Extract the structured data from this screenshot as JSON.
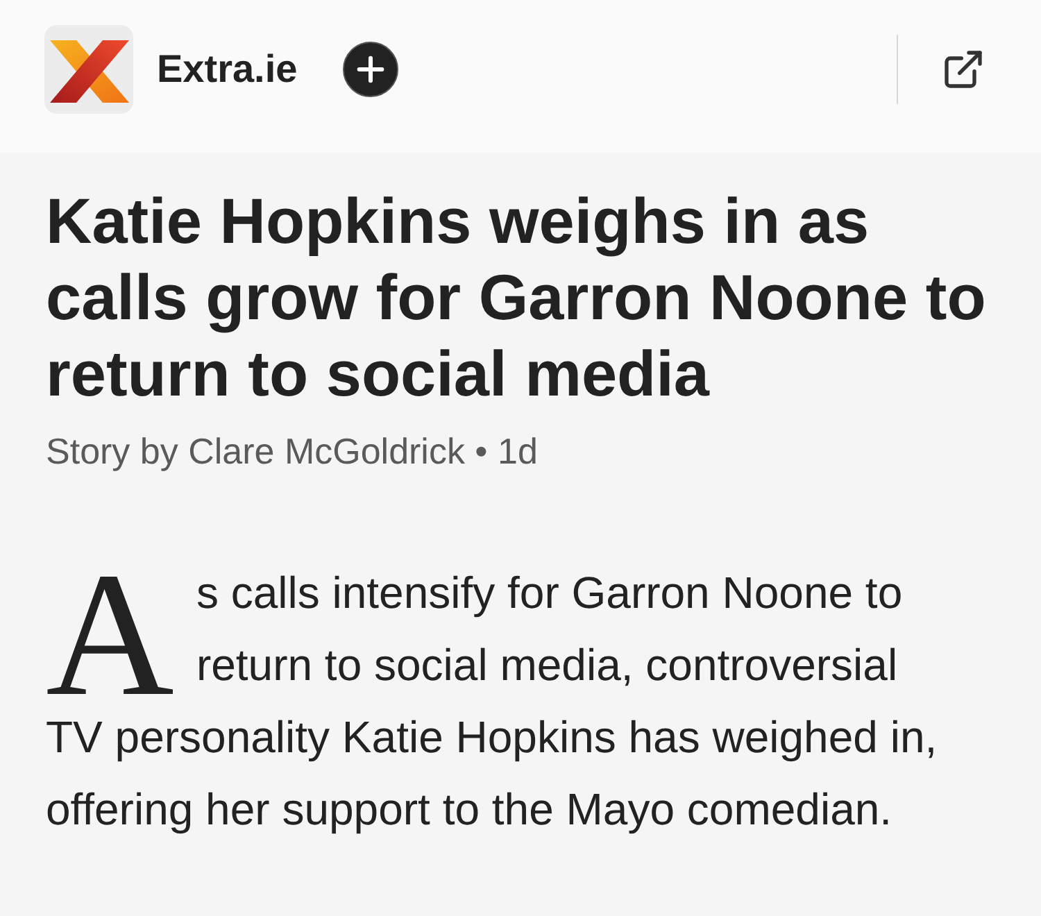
{
  "header": {
    "source_name": "Extra.ie"
  },
  "article": {
    "title": "Katie Hopkins weighs in as calls grow for Garron Noone to return to social media",
    "byline": "Story by Clare McGoldrick • 1d",
    "paragraph": "As calls intensify for Garron Noone to return to social media, controversial TV personality Katie Hopkins has weighed in, offering her support to the Mayo comedian."
  }
}
